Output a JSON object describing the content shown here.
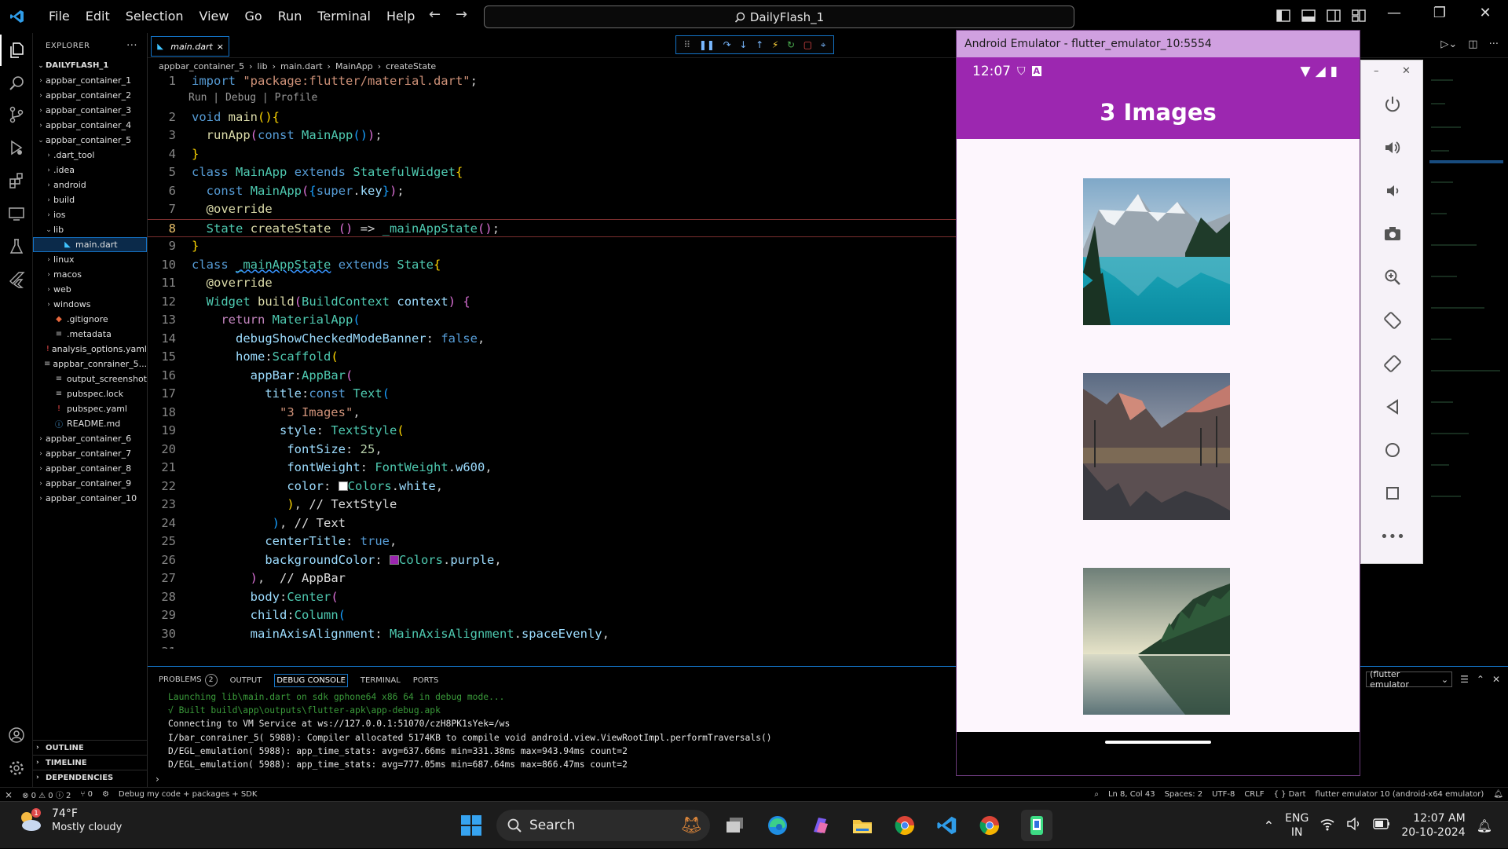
{
  "menu": [
    "File",
    "Edit",
    "Selection",
    "View",
    "Go",
    "Run",
    "Terminal",
    "Help"
  ],
  "search": {
    "text": "DailyFlash_1"
  },
  "explorer": {
    "title": "EXPLORER",
    "root": "DAILYFLASH_1",
    "items": [
      {
        "label": "appbar_container_1",
        "depth": 0,
        "chev": "›",
        "icon": ""
      },
      {
        "label": "appbar_container_2",
        "depth": 0,
        "chev": "›",
        "icon": ""
      },
      {
        "label": "appbar_container_3",
        "depth": 0,
        "chev": "›",
        "icon": ""
      },
      {
        "label": "appbar_container_4",
        "depth": 0,
        "chev": "›",
        "icon": ""
      },
      {
        "label": "appbar_container_5",
        "depth": 0,
        "chev": "⌄",
        "icon": ""
      },
      {
        "label": ".dart_tool",
        "depth": 1,
        "chev": "›",
        "icon": ""
      },
      {
        "label": ".idea",
        "depth": 1,
        "chev": "›",
        "icon": ""
      },
      {
        "label": "android",
        "depth": 1,
        "chev": "›",
        "icon": ""
      },
      {
        "label": "build",
        "depth": 1,
        "chev": "›",
        "icon": ""
      },
      {
        "label": "ios",
        "depth": 1,
        "chev": "›",
        "icon": ""
      },
      {
        "label": "lib",
        "depth": 1,
        "chev": "⌄",
        "icon": ""
      },
      {
        "label": "main.dart",
        "depth": 2,
        "chev": "",
        "icon": "dart"
      },
      {
        "label": "linux",
        "depth": 1,
        "chev": "›",
        "icon": ""
      },
      {
        "label": "macos",
        "depth": 1,
        "chev": "›",
        "icon": ""
      },
      {
        "label": "web",
        "depth": 1,
        "chev": "›",
        "icon": ""
      },
      {
        "label": "windows",
        "depth": 1,
        "chev": "›",
        "icon": ""
      },
      {
        "label": ".gitignore",
        "depth": 1,
        "chev": "",
        "icon": "git"
      },
      {
        "label": ".metadata",
        "depth": 1,
        "chev": "",
        "icon": "list"
      },
      {
        "label": "analysis_options.yaml",
        "depth": 1,
        "chev": "",
        "icon": "excl"
      },
      {
        "label": "appbar_conrainer_5....",
        "depth": 1,
        "chev": "",
        "icon": "list"
      },
      {
        "label": "output_screenshot",
        "depth": 1,
        "chev": "",
        "icon": "list"
      },
      {
        "label": "pubspec.lock",
        "depth": 1,
        "chev": "",
        "icon": "list"
      },
      {
        "label": "pubspec.yaml",
        "depth": 1,
        "chev": "",
        "icon": "excl"
      },
      {
        "label": "README.md",
        "depth": 1,
        "chev": "",
        "icon": "info"
      },
      {
        "label": "appbar_container_6",
        "depth": 0,
        "chev": "›",
        "icon": ""
      },
      {
        "label": "appbar_container_7",
        "depth": 0,
        "chev": "›",
        "icon": ""
      },
      {
        "label": "appbar_container_8",
        "depth": 0,
        "chev": "›",
        "icon": ""
      },
      {
        "label": "appbar_container_9",
        "depth": 0,
        "chev": "›",
        "icon": ""
      },
      {
        "label": "appbar_container_10",
        "depth": 0,
        "chev": "›",
        "icon": ""
      }
    ],
    "sections": [
      "OUTLINE",
      "TIMELINE",
      "DEPENDENCIES"
    ]
  },
  "tab": {
    "label": "main.dart",
    "close": "×"
  },
  "breadcrumb": [
    "appbar_container_5",
    "lib",
    "main.dart",
    "MainApp",
    "createState"
  ],
  "codelens": "Run | Debug | Profile",
  "code_lines": [
    {
      "n": "1",
      "html": "<span class='kw'>import</span> <span class='str'>\"package:flutter/material.dart\"</span>;"
    },
    {
      "n": "2",
      "html": "<span class='kw'>void</span> <span class='fn'>main</span><span class='br1'>()</span><span class='br1'>{</span>"
    },
    {
      "n": "3",
      "html": "  <span class='fn'>runApp</span><span class='br2'>(</span><span class='kw'>const</span> <span class='ty'>MainApp</span><span class='br3'>()</span><span class='br2'>)</span>;"
    },
    {
      "n": "4",
      "html": "<span class='br1'>}</span>"
    },
    {
      "n": "5",
      "html": "<span class='kw'>class</span> <span class='ty'>MainApp</span> <span class='kw'>extends</span> <span class='ty'>StatefulWidget</span><span class='br1'>{</span>"
    },
    {
      "n": "6",
      "html": "  <span class='kw'>const</span> <span class='ty'>MainApp</span><span class='br2'>(</span><span class='br3'>{</span><span class='kw'>super</span>.<span class='pr'>key</span><span class='br3'>}</span><span class='br2'>)</span>;"
    },
    {
      "n": "7",
      "html": "  <span class='fn'>@override</span>"
    },
    {
      "n": "8",
      "html": "  <span class='ty'>State</span> <span class='fn'>createState</span> <span class='br2'>()</span> => <span class='ty'>_mainAppState</span><span class='br2'>()</span>;"
    },
    {
      "n": "9",
      "html": "<span class='br1'>}</span>"
    },
    {
      "n": "10",
      "html": "<span class='kw'>class</span> <span class='ty' style='text-decoration:underline wavy #3794ff'>_mainAppState</span> <span class='kw'>extends</span> <span class='ty'>State</span><span class='br1'>{</span>"
    },
    {
      "n": "11",
      "html": "  <span class='fn'>@override</span>"
    },
    {
      "n": "12",
      "html": "  <span class='ty'>Widget</span> <span class='fn'>build</span><span class='br2'>(</span><span class='ty'>BuildContext</span> <span class='pr'>context</span><span class='br2'>)</span> <span class='br2'>{</span>"
    },
    {
      "n": "13",
      "html": "    <span class='ctl'>return</span> <span class='ty'>MaterialApp</span><span class='br3'>(</span>"
    },
    {
      "n": "14",
      "html": "      <span class='pr'>debugShowCheckedModeBanner</span>: <span class='kw'>false</span>,"
    },
    {
      "n": "15",
      "html": "      <span class='pr'>home</span>:<span class='ty'>Scaffold</span><span class='br1'>(</span>"
    },
    {
      "n": "16",
      "html": "        <span class='pr'>appBar</span>:<span class='ty'>AppBar</span><span class='br2'>(</span>"
    },
    {
      "n": "17",
      "html": "          <span class='pr'>title</span>:<span class='kw'>const</span> <span class='ty'>Text</span><span class='br3'>(</span>"
    },
    {
      "n": "18",
      "html": "            <span class='str'>\"3 Images\"</span>,"
    },
    {
      "n": "19",
      "html": "            <span class='pr'>style</span>: <span class='ty'>TextStyle</span><span class='br1'>(</span>"
    },
    {
      "n": "20",
      "html": "             <span class='pr'>fontSize</span>: <span class='num'>25</span>,"
    },
    {
      "n": "21",
      "html": "             <span class='pr'>fontWeight</span>: <span class='ty'>FontWeight</span>.<span class='pr'>w600</span>,"
    },
    {
      "n": "22",
      "html": "             <span class='pr'>color</span>: <span style='display:inline-block;width:12px;height:12px;background:#fff;border:1px solid #888;vertical-align:middle'></span><span class='ty'>Colors</span>.<span class='pr'>white</span>,"
    },
    {
      "n": "23",
      "html": "             <span class='br1'>)</span>, <span class='cm'>// TextStyle</span>"
    },
    {
      "n": "24",
      "html": "           <span class='br3'>)</span>, <span class='cm'>// Text</span>"
    },
    {
      "n": "25",
      "html": "          <span class='pr'>centerTitle</span>: <span class='kw'>true</span>,"
    },
    {
      "n": "26",
      "html": "          <span class='pr'>backgroundColor</span>: <span style='display:inline-block;width:12px;height:12px;background:#9c27b0;border:1px solid #888;vertical-align:middle'></span><span class='ty'>Colors</span>.<span class='pr'>purple</span>,"
    },
    {
      "n": "27",
      "html": "        <span class='br2'>)</span>,  <span class='cm'>// AppBar</span>"
    },
    {
      "n": "28",
      "html": "        <span class='pr'>body</span>:<span class='ty'>Center</span><span class='br2'>(</span>"
    },
    {
      "n": "29",
      "html": "        <span class='pr'>child</span>:<span class='ty'>Column</span><span class='br3'>(</span>"
    },
    {
      "n": "30",
      "html": "        <span class='pr'>mainAxisAlignment</span>: <span class='ty'>MainAxisAlignment</span>.<span class='pr'>spaceEvenly</span>,"
    },
    {
      "n": "31",
      "html": ""
    }
  ],
  "panel": {
    "tabs": [
      "PROBLEMS",
      "OUTPUT",
      "DEBUG CONSOLE",
      "TERMINAL",
      "PORTS"
    ],
    "problems_count": "2",
    "debug_target": "(flutter emulator",
    "console": [
      {
        "text": "Launching lib\\main.dart on sdk gphone64 x86 64 in debug mode...",
        "color": "#3a9a3a"
      },
      {
        "text": "√ Built build\\app\\outputs\\flutter-apk\\app-debug.apk",
        "color": "#3a9a3a"
      },
      {
        "text": "Connecting to VM Service at ws://127.0.0.1:51070/czH8PK1sYek=/ws",
        "color": "#e6e6e6"
      },
      {
        "text": "I/bar_conrainer_5( 5988): Compiler allocated 5174KB to compile void android.view.ViewRootImpl.performTraversals()",
        "color": "#e6e6e6"
      },
      {
        "text": "D/EGL_emulation( 5988): app_time_stats: avg=637.66ms min=331.38ms max=943.94ms count=2",
        "color": "#e6e6e6"
      },
      {
        "text": "D/EGL_emulation( 5988): app_time_stats: avg=777.05ms min=687.64ms max=866.47ms count=2",
        "color": "#e6e6e6"
      }
    ]
  },
  "statusbar": {
    "remote": "⨯",
    "errors": "⊗ 0 ⚠ 0 ⓘ 2",
    "ports": "⑂ 0",
    "debug": "Debug my code + packages + SDK",
    "position": "Ln 8, Col 43",
    "spaces": "Spaces: 2",
    "encoding": "UTF-8",
    "eol": "CRLF",
    "language": "{ } Dart",
    "device": "flutter emulator 10 (android-x64 emulator)"
  },
  "emulator": {
    "title": "Android Emulator - flutter_emulator_10:5554",
    "time": "12:07",
    "appbar_title": "3 Images"
  },
  "taskbar": {
    "temp": "74°F",
    "weather": "Mostly cloudy",
    "search": "Search",
    "lang1": "ENG",
    "lang2": "IN",
    "time": "12:07 AM",
    "date": "20-10-2024",
    "notif": "1"
  }
}
